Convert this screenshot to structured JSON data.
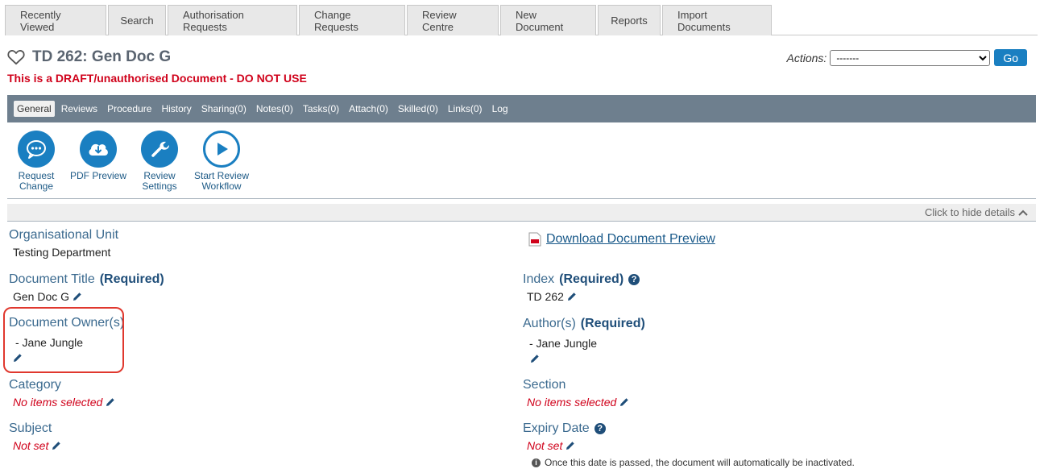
{
  "top_tabs": [
    {
      "label": "Recently Viewed"
    },
    {
      "label": "Search"
    },
    {
      "label": "Authorisation Requests"
    },
    {
      "label": "Change Requests"
    },
    {
      "label": "Review Centre"
    },
    {
      "label": "New Document"
    },
    {
      "label": "Reports"
    },
    {
      "label": "Import Documents"
    }
  ],
  "header": {
    "title": "TD 262: Gen Doc G",
    "warning": "This is a DRAFT/unauthorised Document - DO NOT USE",
    "actions_label": "Actions:",
    "actions_selected": "-------",
    "go_label": "Go"
  },
  "sub_tabs": [
    {
      "label": "General"
    },
    {
      "label": "Reviews"
    },
    {
      "label": "Procedure"
    },
    {
      "label": "History"
    },
    {
      "label": "Sharing(0)"
    },
    {
      "label": "Notes(0)"
    },
    {
      "label": "Tasks(0)"
    },
    {
      "label": "Attach(0)"
    },
    {
      "label": "Skilled(0)"
    },
    {
      "label": "Links(0)"
    },
    {
      "label": "Log"
    }
  ],
  "action_buttons": {
    "request_change": {
      "line1": "Request",
      "line2": "Change"
    },
    "pdf_preview": {
      "line1": "PDF Preview"
    },
    "review_settings": {
      "line1": "Review",
      "line2": "Settings"
    },
    "start_review": {
      "line1": "Start Review",
      "line2": "Workflow"
    }
  },
  "details": {
    "hide_label": "Click to hide details",
    "download_link": "Download Document Preview",
    "required_label": "(Required)",
    "org_unit": {
      "label": "Organisational Unit",
      "value": "Testing Department"
    },
    "doc_title": {
      "label": "Document Title",
      "value": "Gen Doc G"
    },
    "doc_owner": {
      "label": "Document Owner(s)",
      "value": "- Jane Jungle"
    },
    "category": {
      "label": "Category",
      "value": "No items selected"
    },
    "subject": {
      "label": "Subject",
      "value": "Not set"
    },
    "index": {
      "label": "Index",
      "value": "TD 262"
    },
    "authors": {
      "label": "Author(s)",
      "value": "- Jane Jungle"
    },
    "section": {
      "label": "Section",
      "value": "No items selected"
    },
    "expiry": {
      "label": "Expiry Date",
      "value": "Not set",
      "note": "Once this date is passed, the document will automatically be inactivated."
    }
  },
  "colors": {
    "accent": "#1a7fc1",
    "warning": "#d0021b",
    "subnav_bg": "#6e7f8e",
    "highlight": "#e0382e"
  }
}
